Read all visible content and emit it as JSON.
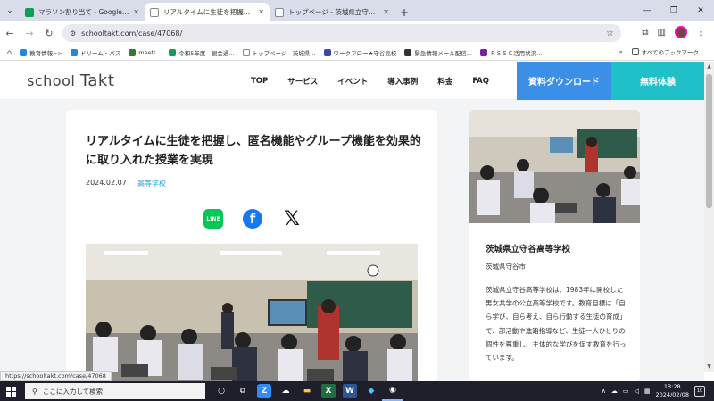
{
  "browser": {
    "tabs": [
      {
        "title": "マラソン割り当て - Google スプレッ",
        "favicon_color": "#0f9d58",
        "active": false
      },
      {
        "title": "リアルタイムに生徒を把握し、匿名",
        "favicon_color": "#7a8694",
        "active": true
      },
      {
        "title": "トップページ - 茨城県立守谷高等学",
        "favicon_color": "#888888",
        "active": false
      }
    ],
    "url": "schooltakt.com/case/47068/",
    "bookmarks": [
      {
        "label": "教育情報>>",
        "color": "#1e88e5"
      },
      {
        "label": "ドリーム・パス",
        "color": "#1e88e5"
      },
      {
        "label": "meeti...",
        "color": "#2e7d32"
      },
      {
        "label": "令和5年度　観会通...",
        "color": "#0f9d58"
      },
      {
        "label": "トップページ - 茨城県...",
        "color": "#888888"
      },
      {
        "label": "ワークフロー★守谷高校",
        "color": "#3949ab"
      },
      {
        "label": "緊急情報メール配信...",
        "color": "#333333"
      },
      {
        "label": "ＲＳＳＣ活用状況...",
        "color": "#7b1fa2"
      }
    ],
    "bookmarks_overflow": "»",
    "all_bookmarks_label": "すべてのブックマーク",
    "status_url": "https://schooltakt.com/case/47068"
  },
  "site": {
    "logo_prefix": "school",
    "logo_suffix": "Takt",
    "nav": [
      "TOP",
      "サービス",
      "イベント",
      "導入事例",
      "料金",
      "FAQ"
    ],
    "cta_download": "資料ダウンロード",
    "cta_trial": "無料体験"
  },
  "article": {
    "title": "リアルタイムに生徒を把握し、匿名機能やグループ機能を効果的に取り入れた授業を実現",
    "date": "2024.02.07",
    "category": "高等学校",
    "share_line": "LINE",
    "share_facebook": "f",
    "share_x": "𝕏"
  },
  "school": {
    "name": "茨城県立守谷高等学校",
    "location": "茨城県守谷市",
    "description": "茨城県立守谷高等学校は、1983年に開校した男女共学の公立高等学校です。教育目標は「自ら学び、自ら考え、自ら行動する生徒の育成」で、部活動や進路指導など、生徒一人ひとりの個性を尊重し、主体的な学びを促す教育を行っています。"
  },
  "taskbar": {
    "search_placeholder": "ここに入力して検索",
    "time": "13:28",
    "date": "2024/02/08",
    "notification_count": "10"
  }
}
